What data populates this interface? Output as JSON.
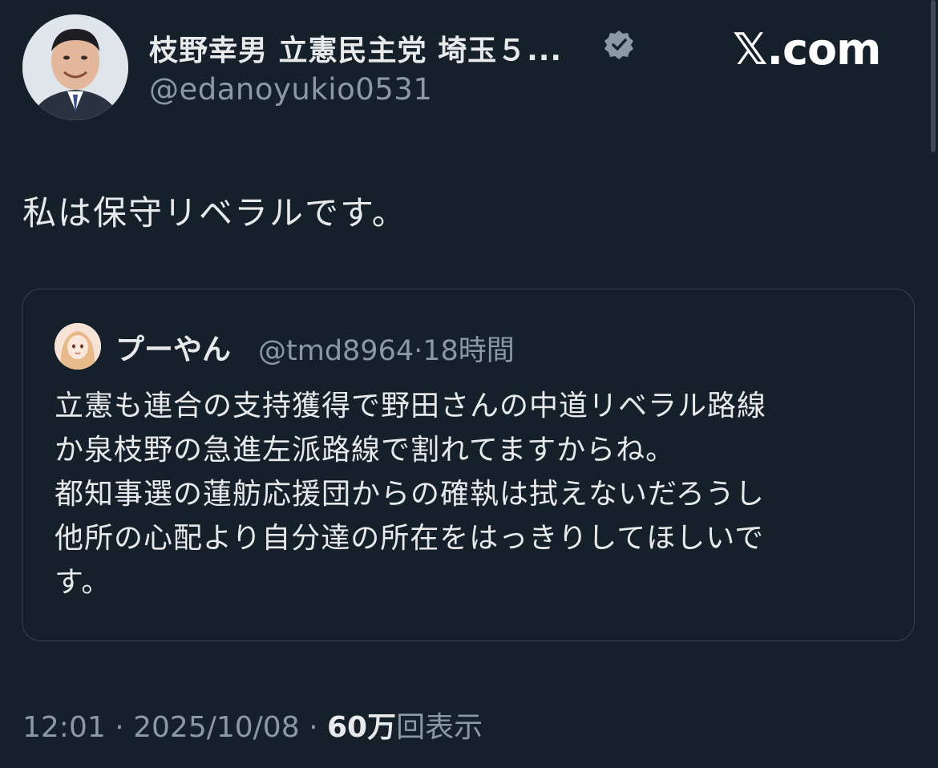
{
  "author": {
    "display_name": "枝野幸男 立憲民主党 埼玉５...",
    "handle": "@edanoyukio0531",
    "avatar_icon": "person-photo-icon",
    "verified_icon": "verified-badge-icon"
  },
  "brand": {
    "label": "𝕏.com"
  },
  "tweet": {
    "text": "私は保守リベラルです。"
  },
  "quote": {
    "display_name": "プーやん",
    "handle": "@tmd8964",
    "separator": "·",
    "time": "18時間",
    "lines": [
      "立憲も連合の支持獲得で野田さんの中道リベラル路線",
      "か泉枝野の急進左派路線で割れてますからね。",
      "都知事選の蓮舫応援団からの確執は拭えないだろうし",
      "他所の心配より自分達の所在をはっきりしてほしいで",
      "す。"
    ]
  },
  "footer": {
    "time": "12:01",
    "sep1": "·",
    "date": "2025/10/08",
    "sep2": "·",
    "views": "60万",
    "views_label": "回表示"
  },
  "colors": {
    "background": "#15202b",
    "text": "#e7e9ea",
    "secondary": "#8b98a5",
    "border": "#38444d"
  }
}
